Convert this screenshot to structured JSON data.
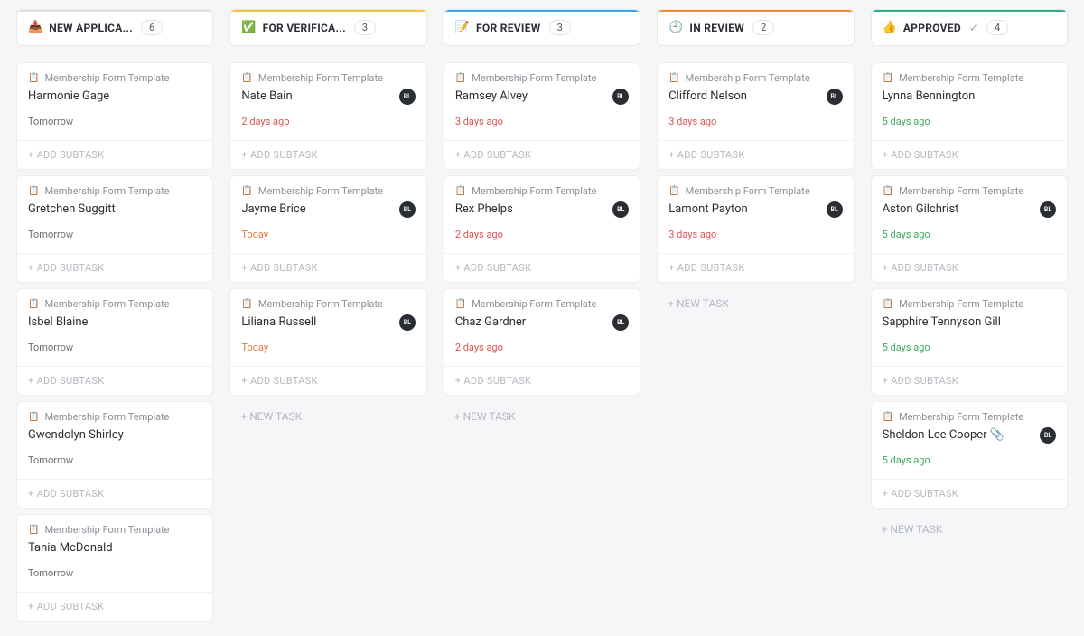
{
  "common": {
    "template_label": "Membership Form Template",
    "add_subtask": "+ ADD SUBTASK",
    "new_task": "+ NEW TASK",
    "avatar_initials": "BL"
  },
  "columns": [
    {
      "id": "new-applications",
      "stripe": "#e0e0e0",
      "icon": "📥",
      "title": "NEW APPLICA...",
      "count": "6",
      "extra": "",
      "cards": [
        {
          "name": "Harmonie Gage",
          "date": "Tomorrow",
          "date_class": "neutral",
          "avatar": false
        },
        {
          "name": "Gretchen Suggitt",
          "date": "Tomorrow",
          "date_class": "neutral",
          "avatar": false
        },
        {
          "name": "Isbel Blaine",
          "date": "Tomorrow",
          "date_class": "neutral",
          "avatar": false
        },
        {
          "name": "Gwendolyn Shirley",
          "date": "Tomorrow",
          "date_class": "neutral",
          "avatar": false
        },
        {
          "name": "Tania McDonald",
          "date": "Tomorrow",
          "date_class": "neutral",
          "avatar": false
        }
      ],
      "show_new_task": false
    },
    {
      "id": "for-verification",
      "stripe": "#f5c236",
      "icon": "✅",
      "title": "FOR VERIFICA...",
      "count": "3",
      "extra": "",
      "cards": [
        {
          "name": "Nate Bain",
          "date": "2 days ago",
          "date_class": "danger",
          "avatar": true
        },
        {
          "name": "Jayme Brice",
          "date": "Today",
          "date_class": "warn",
          "avatar": true
        },
        {
          "name": "Liliana Russell",
          "date": "Today",
          "date_class": "warn",
          "avatar": true
        }
      ],
      "show_new_task": true
    },
    {
      "id": "for-review",
      "stripe": "#3ba7e8",
      "icon": "📝",
      "title": "FOR REVIEW",
      "count": "3",
      "extra": "",
      "cards": [
        {
          "name": "Ramsey Alvey",
          "date": "3 days ago",
          "date_class": "danger",
          "avatar": true
        },
        {
          "name": "Rex Phelps",
          "date": "2 days ago",
          "date_class": "danger",
          "avatar": true
        },
        {
          "name": "Chaz Gardner",
          "date": "2 days ago",
          "date_class": "danger",
          "avatar": true
        }
      ],
      "show_new_task": true
    },
    {
      "id": "in-review",
      "stripe": "#f28c28",
      "icon": "🕘",
      "title": "IN REVIEW",
      "count": "2",
      "extra": "",
      "cards": [
        {
          "name": "Clifford Nelson",
          "date": "3 days ago",
          "date_class": "danger",
          "avatar": true
        },
        {
          "name": "Lamont Payton",
          "date": "3 days ago",
          "date_class": "danger",
          "avatar": true
        }
      ],
      "show_new_task": true
    },
    {
      "id": "approved",
      "stripe": "#2ab27b",
      "icon": "👍",
      "title": "APPROVED",
      "count": "4",
      "extra": "✓",
      "cards": [
        {
          "name": "Lynna Bennington",
          "date": "5 days ago",
          "date_class": "success",
          "avatar": false
        },
        {
          "name": "Aston Gilchrist",
          "date": "5 days ago",
          "date_class": "success",
          "avatar": true
        },
        {
          "name": "Sapphire Tennyson Gill",
          "date": "5 days ago",
          "date_class": "success",
          "avatar": false
        },
        {
          "name": "Sheldon Lee Cooper 📎",
          "date": "5 days ago",
          "date_class": "success",
          "avatar": true
        }
      ],
      "show_new_task": true
    }
  ]
}
